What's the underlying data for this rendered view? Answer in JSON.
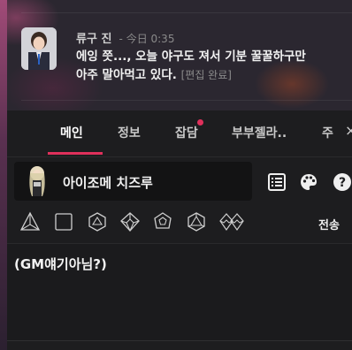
{
  "message": {
    "author": "류구 진",
    "time": "- 今日 0:35",
    "text_line1": "에잉 쯧..., 오늘 야구도 져서 기분 꿀꿀하구만",
    "text_line2": "아주 말아먹고 있다.",
    "edited": "[편집 완료]"
  },
  "tabs": [
    {
      "label": "메인",
      "active": true
    },
    {
      "label": "정보",
      "active": false
    },
    {
      "label": "잡담",
      "active": false,
      "has_notification": true
    },
    {
      "label": "부부젤라..",
      "active": false
    },
    {
      "label": "주",
      "active": false
    }
  ],
  "tab_close_label": "×",
  "character": {
    "name": "아이조메 치즈루"
  },
  "toolbar": {
    "list_icon": "list-icon",
    "palette_icon": "palette-icon",
    "help_icon": "help-icon"
  },
  "dice": [
    "d4-icon",
    "d6-icon",
    "d8-icon",
    "d10-icon",
    "d12-icon",
    "d20-icon",
    "d100-icon"
  ],
  "send_label": "전송",
  "input_value": "(GM얘기아님?)",
  "colors": {
    "accent": "#e0305b",
    "panel_bg": "#1d1d1f",
    "input_bg": "#131314"
  }
}
